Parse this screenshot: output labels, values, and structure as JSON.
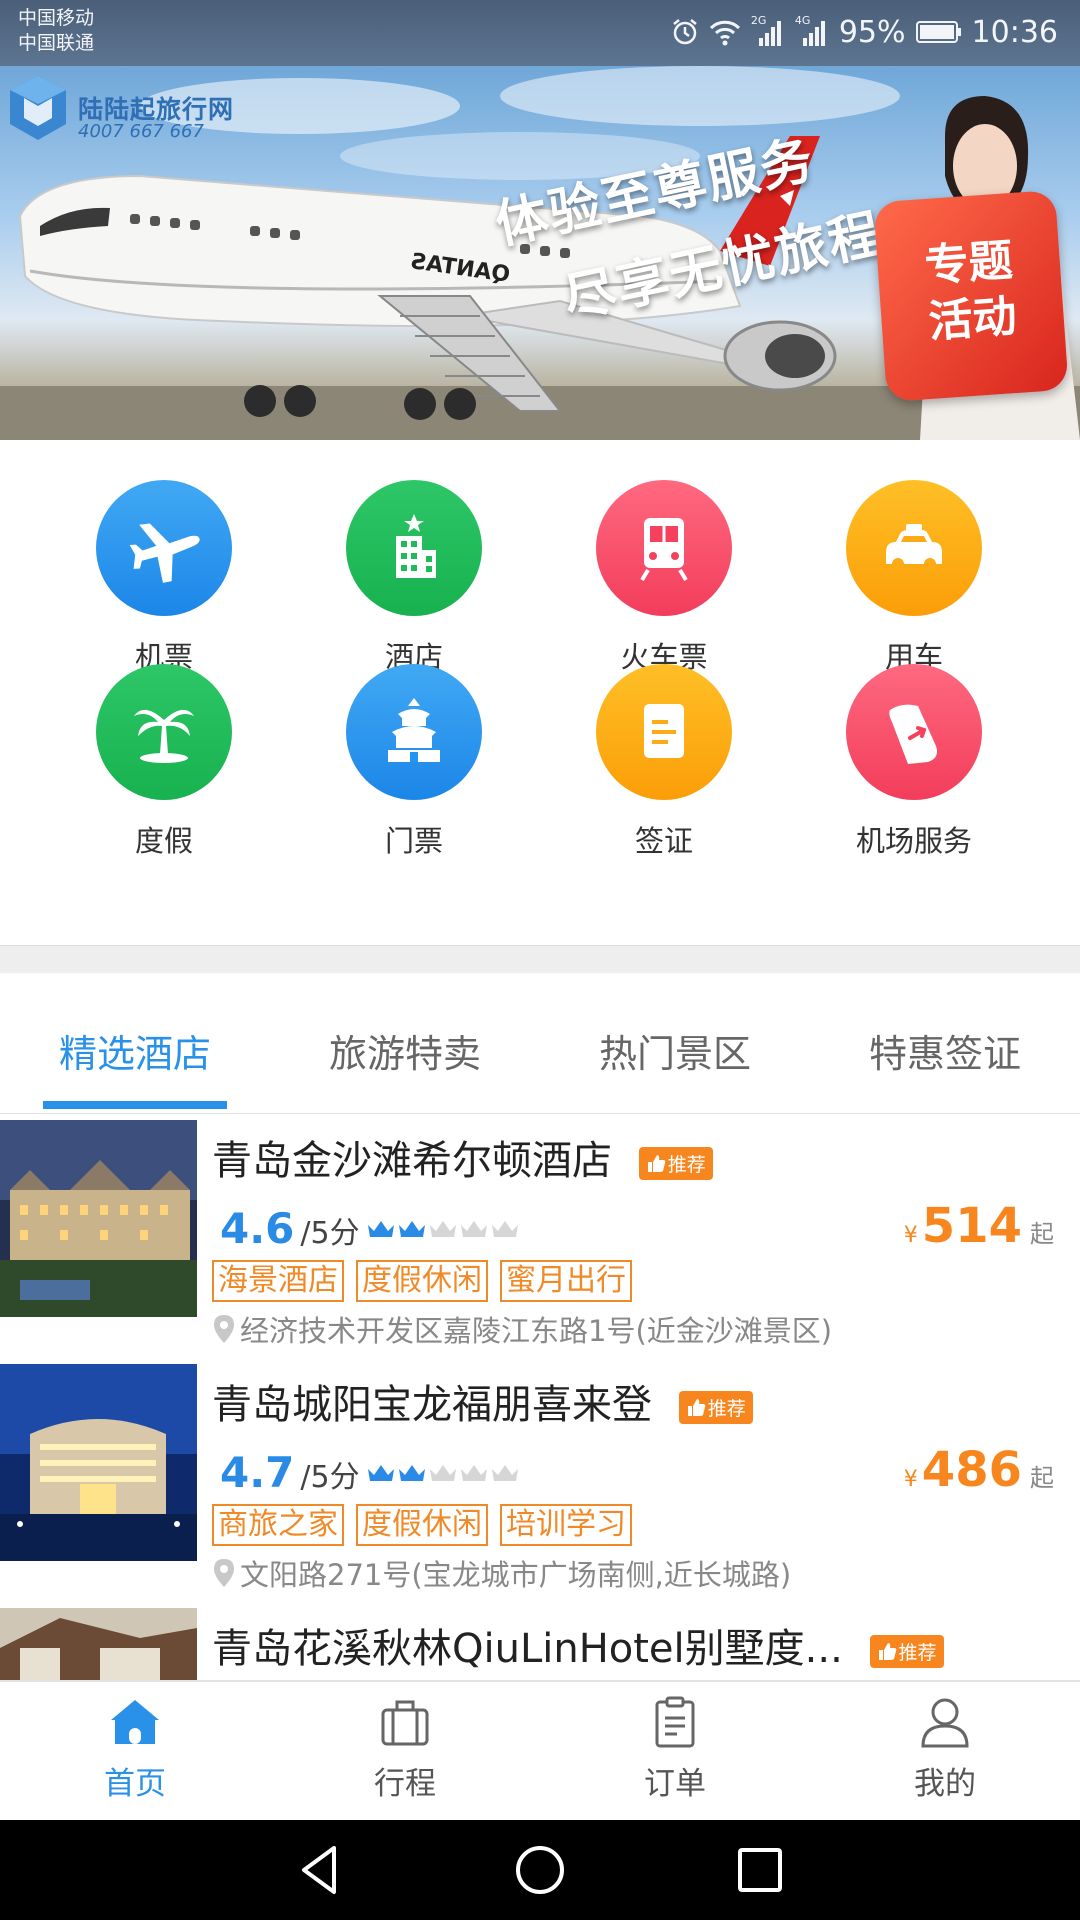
{
  "status_bar": {
    "carrier_1": "中国移动",
    "carrier_2": "中国联通",
    "net_2g": "2G",
    "net_4g": "4G",
    "battery": "95%",
    "time": "10:36"
  },
  "banner": {
    "brand_name": "陆陆起旅行网",
    "brand_phone": "4007 667 667",
    "slogan_line1": "体验至尊服务",
    "slogan_line2": "尽享无忧旅程",
    "badge_line1": "专题",
    "badge_line2": "活动",
    "airline_text": "QANTAS"
  },
  "categories": [
    {
      "label": "机票",
      "icon": "airplane-icon",
      "color": "#2196F3"
    },
    {
      "label": "酒店",
      "icon": "hotel-icon",
      "color": "#1DB954"
    },
    {
      "label": "火车票",
      "icon": "train-icon",
      "color": "#F5405E"
    },
    {
      "label": "用车",
      "icon": "car-icon",
      "color": "#FCA514"
    },
    {
      "label": "度假",
      "icon": "palm-tree-icon",
      "color": "#1DB954"
    },
    {
      "label": "门票",
      "icon": "temple-icon",
      "color": "#2196F3"
    },
    {
      "label": "签证",
      "icon": "visa-icon",
      "color": "#FCA514"
    },
    {
      "label": "机场服务",
      "icon": "airport-service-icon",
      "color": "#F5405E"
    }
  ],
  "tabs": [
    {
      "label": "精选酒店",
      "active": true
    },
    {
      "label": "旅游特卖",
      "active": false
    },
    {
      "label": "热门景区",
      "active": false
    },
    {
      "label": "特惠签证",
      "active": false
    }
  ],
  "recommend_label": "推荐",
  "hotels": [
    {
      "name": "青岛金沙滩希尔顿酒店",
      "score": "4.6",
      "score_suffix": "/5分",
      "crowns": 2,
      "price_symbol": "¥",
      "price": "514",
      "price_suffix": "起",
      "tags": [
        "海景酒店",
        "度假休闲",
        "蜜月出行"
      ],
      "address": "经济技术开发区嘉陵江东路1号(近金沙滩景区)"
    },
    {
      "name": "青岛城阳宝龙福朋喜来登",
      "score": "4.7",
      "score_suffix": "/5分",
      "crowns": 2,
      "price_symbol": "¥",
      "price": "486",
      "price_suffix": "起",
      "tags": [
        "商旅之家",
        "度假休闲",
        "培训学习"
      ],
      "address": "文阳路271号(宝龙城市广场南侧,近长城路)"
    },
    {
      "name": "青岛花溪秋林QiuLinHotel别墅度..."
    }
  ],
  "bottom_nav": [
    {
      "label": "首页",
      "icon": "home-icon",
      "active": true
    },
    {
      "label": "行程",
      "icon": "suitcase-icon",
      "active": false
    },
    {
      "label": "订单",
      "icon": "order-icon",
      "active": false
    },
    {
      "label": "我的",
      "icon": "profile-icon",
      "active": false
    }
  ],
  "colors": {
    "accent": "#2A91E8",
    "price": "#F7861F",
    "tag": "#F08A28"
  }
}
